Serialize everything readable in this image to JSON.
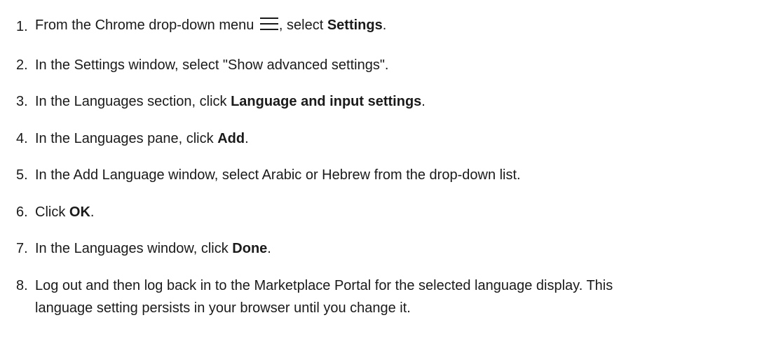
{
  "steps": [
    {
      "number": "1.",
      "before": "From the Chrome drop-down menu ",
      "icon": "hamburger-menu-icon",
      "after": ", select ",
      "bold": "Settings",
      "end": "."
    },
    {
      "number": "2.",
      "text": "In the Settings window, select \"Show advanced settings\"."
    },
    {
      "number": "3.",
      "before": "In the Languages section, click ",
      "bold": "Language and input settings",
      "end": "."
    },
    {
      "number": "4.",
      "before": "In the Languages pane, click ",
      "bold": "Add",
      "end": "."
    },
    {
      "number": "5.",
      "text": "In the Add Language window, select Arabic or Hebrew from the drop-down list."
    },
    {
      "number": "6.",
      "before": "Click ",
      "bold": "OK",
      "end": "."
    },
    {
      "number": "7.",
      "before": "In the Languages window, click ",
      "bold": "Done",
      "end": "."
    },
    {
      "number": "8.",
      "line1": "Log out and then log back in to the Marketplace Portal for the selected language display. This",
      "line2": "language setting persists in your browser until you change it."
    }
  ]
}
